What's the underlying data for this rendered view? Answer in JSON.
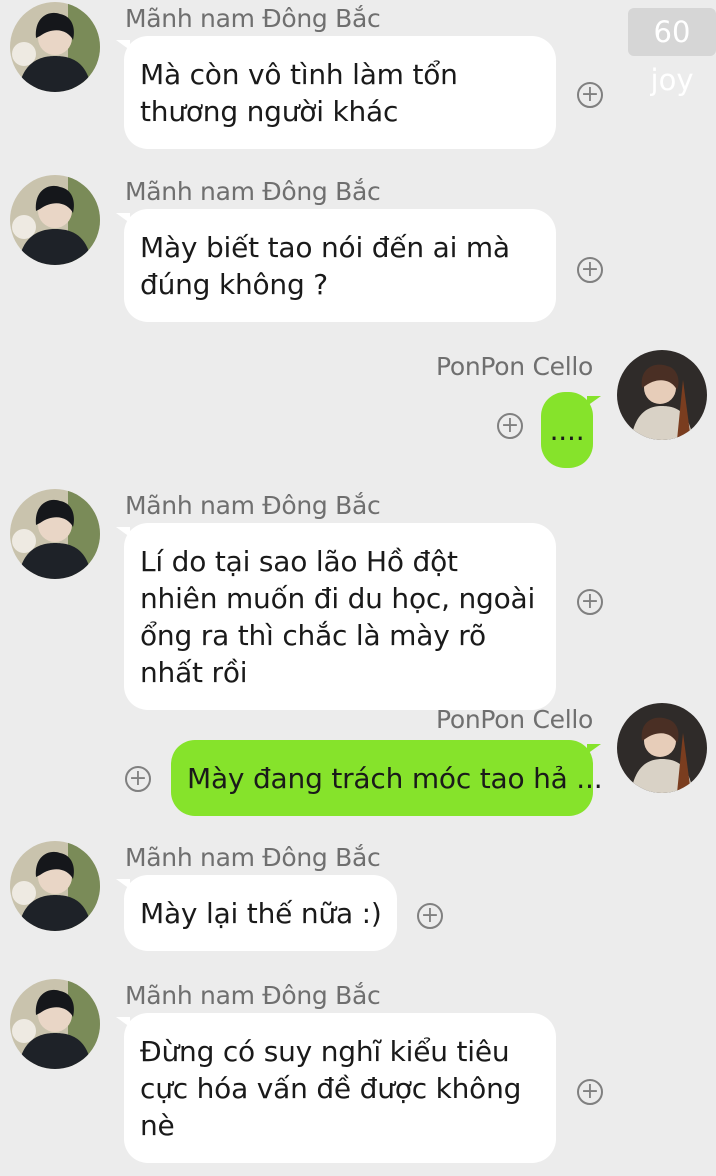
{
  "watermark": "60 joy",
  "messages": [
    {
      "sender": "Mãnh nam Đông Bắc",
      "text": "Mà còn vô tình làm tổn thương người khác",
      "side": "in"
    },
    {
      "sender": "Mãnh nam Đông Bắc",
      "text": "Mày biết tao nói đến ai mà đúng không ?",
      "side": "in"
    },
    {
      "sender": "PonPon Cello",
      "text": "....",
      "side": "out"
    },
    {
      "sender": "Mãnh nam Đông Bắc",
      "text": "Lí do tại sao lão Hồ đột nhiên muốn đi du học, ngoài ổng ra thì chắc là mày rõ nhất rồi",
      "side": "in"
    },
    {
      "sender": "PonPon Cello",
      "text": "Mày đang trách móc tao hả ...",
      "side": "out"
    },
    {
      "sender": "Mãnh nam Đông Bắc",
      "text": "Mày lại thế nữa  :)",
      "side": "in"
    },
    {
      "sender": "Mãnh nam Đông Bắc",
      "text": "Đừng có suy nghĩ kiểu tiêu cực hóa vấn đề được không nè",
      "side": "in"
    }
  ],
  "icons": {
    "reaction": "add-reaction-icon",
    "avatar_in": "avatar-dark-suit",
    "avatar_out": "avatar-cello-player"
  },
  "colors": {
    "background": "#ececec",
    "incoming_bubble": "#ffffff",
    "outgoing_bubble": "#86e32b",
    "sender_name": "#6f6f6f"
  }
}
